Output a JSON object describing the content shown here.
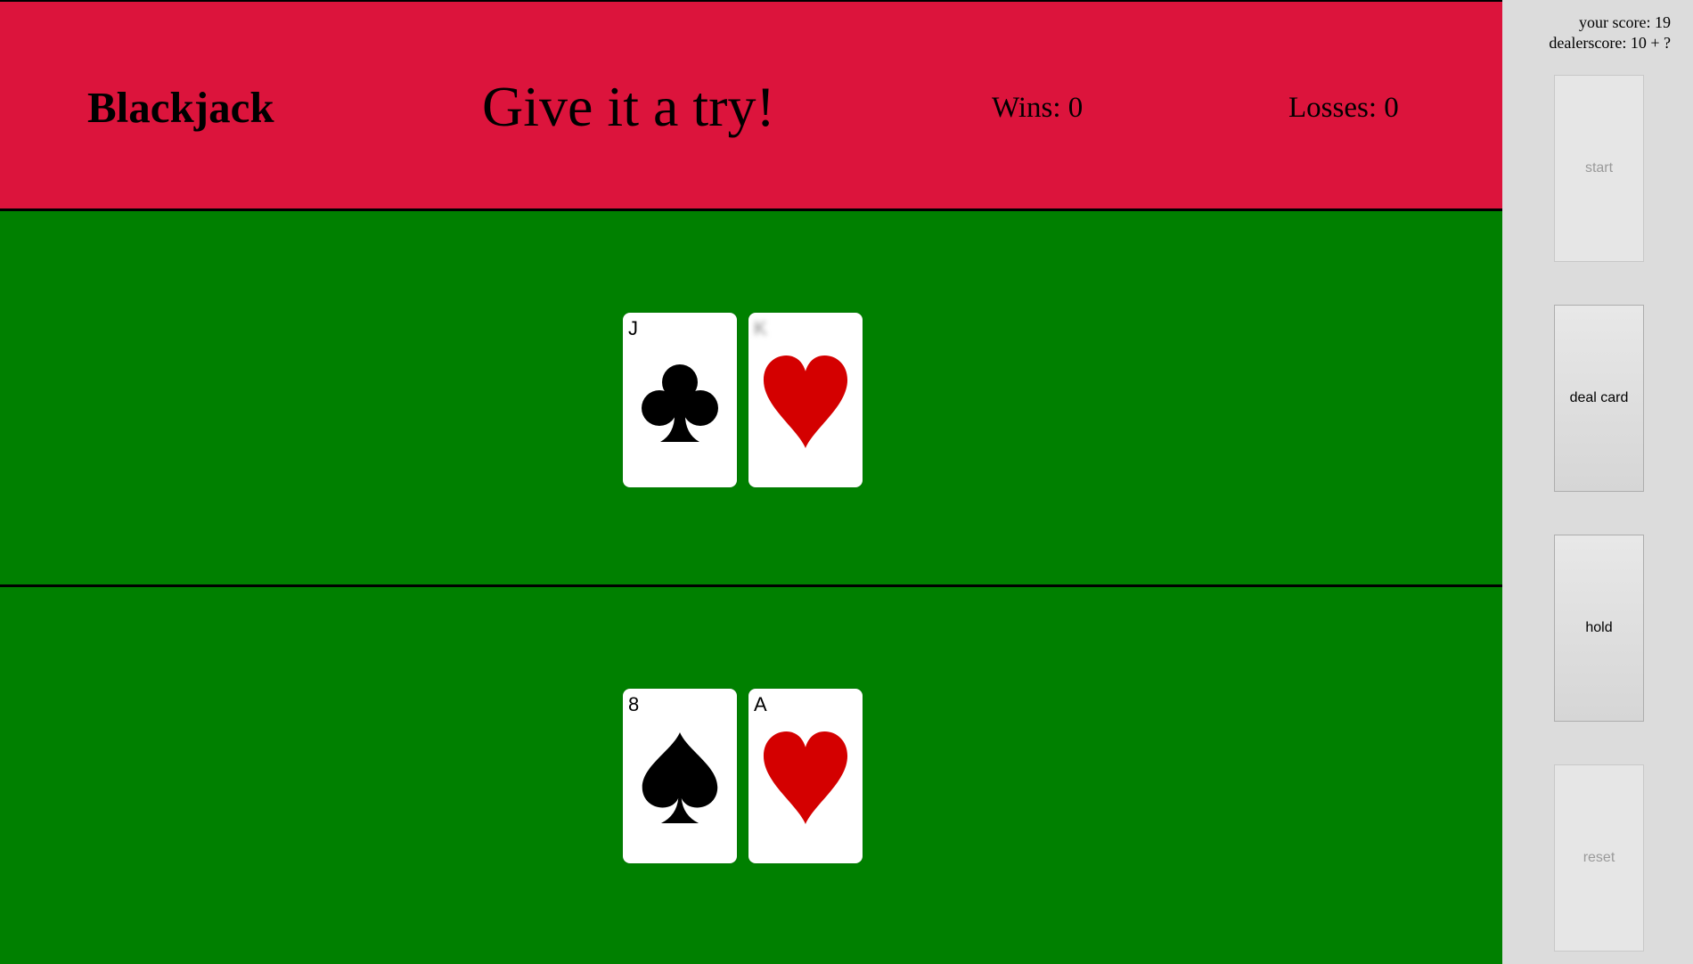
{
  "header": {
    "title": "Blackjack",
    "message": "Give it a try!",
    "wins": "Wins: 0",
    "losses": "Losses: 0"
  },
  "dealer": {
    "cards": [
      {
        "rank": "J",
        "suit": "clubs",
        "suit_icon": "club-icon",
        "color": "#000000"
      },
      {
        "rank": "K",
        "suit": "hearts",
        "suit_icon": "heart-icon",
        "color": "#d40000",
        "hidden_rank": true
      }
    ]
  },
  "player": {
    "cards": [
      {
        "rank": "8",
        "suit": "spades",
        "suit_icon": "spade-icon",
        "color": "#000000"
      },
      {
        "rank": "A",
        "suit": "hearts",
        "suit_icon": "heart-icon",
        "color": "#d40000"
      }
    ]
  },
  "sidebar": {
    "your_score": "your score: 19",
    "dealer_score": "dealerscore: 10 + ?",
    "buttons": {
      "start": "start",
      "deal": "deal card",
      "hold": "hold",
      "reset": "reset"
    }
  },
  "colors": {
    "header": "#dc143c",
    "table": "#008000",
    "sidebar": "#dcdcdc",
    "red_suit": "#d40000"
  }
}
